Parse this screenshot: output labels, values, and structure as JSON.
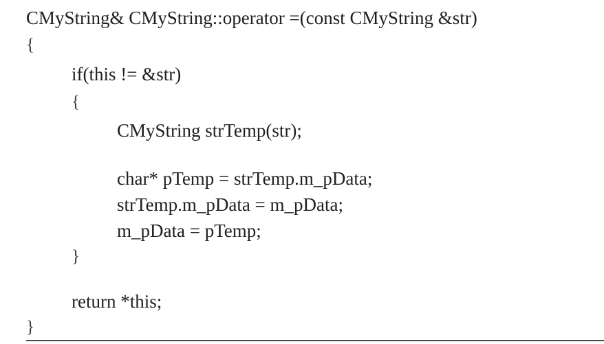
{
  "code": {
    "line_1": "CMyString& CMyString::operator =(const CMyString &str)",
    "line_2": "{",
    "line_3": "if(this != &str)",
    "line_4": "{",
    "line_5": "CMyString strTemp(str);",
    "line_6": "char* pTemp = strTemp.m_pData;",
    "line_7": "strTemp.m_pData = m_pData;",
    "line_8": "m_pData = pTemp;",
    "line_9": "}",
    "line_10": "return *this;",
    "line_11": "}"
  }
}
